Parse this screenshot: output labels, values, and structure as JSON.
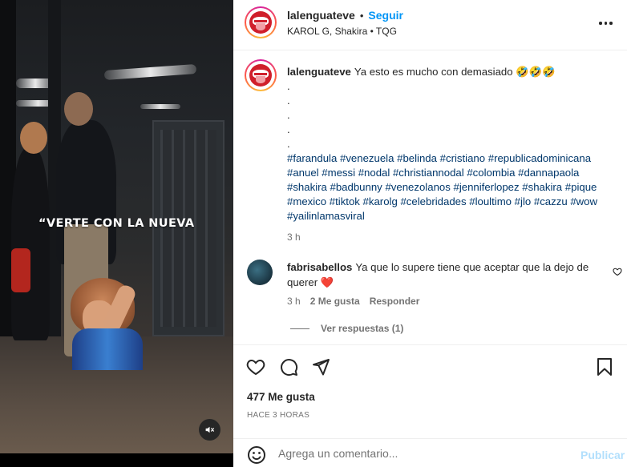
{
  "media": {
    "overlay_caption": "“VERTE CON LA NUEVA",
    "mute_icon": "speaker-muted-icon"
  },
  "header": {
    "username": "lalenguateve",
    "separator": "•",
    "follow_label": "Seguir",
    "audio_line": "KAROL G, Shakira • TQG",
    "more_icon": "more-options-icon"
  },
  "caption": {
    "username": "lalenguateve",
    "text": "Ya esto es mucho con demasiado 🤣🤣🤣",
    "dots": [
      ".",
      ".",
      ".",
      ".",
      "."
    ],
    "hashtags": "#farandula #venezuela #belinda #cristiano #republicadominicana #anuel #messi #nodal #christiannodal #colombia #dannapaola #shakira #badbunny #venezolanos #jenniferlopez #shakira #pique #mexico #tiktok #karolg #celebridades #loultimo #jlo #cazzu #wow #yailinlamasviral",
    "time": "3 h"
  },
  "comment": {
    "username": "fabrisabellos",
    "text": "Ya que lo supere tiene que aceptar que la dejo de querer ❤️",
    "time": "3 h",
    "likes": "2 Me gusta",
    "reply_label": "Responder",
    "view_replies": "Ver respuestas (1)"
  },
  "actions": {
    "likes_count": "477 Me gusta",
    "time_ago": "HACE 3 HORAS"
  },
  "composer": {
    "emoji_icon": "emoji-icon",
    "placeholder": "Agrega un comentario...",
    "publish_label": "Publicar"
  },
  "colors": {
    "link_blue": "#0095f6",
    "hashtag_blue": "#00376b",
    "muted_text": "#737373",
    "heart_red": "#ed4956",
    "publish_disabled": "#b2dffc"
  }
}
